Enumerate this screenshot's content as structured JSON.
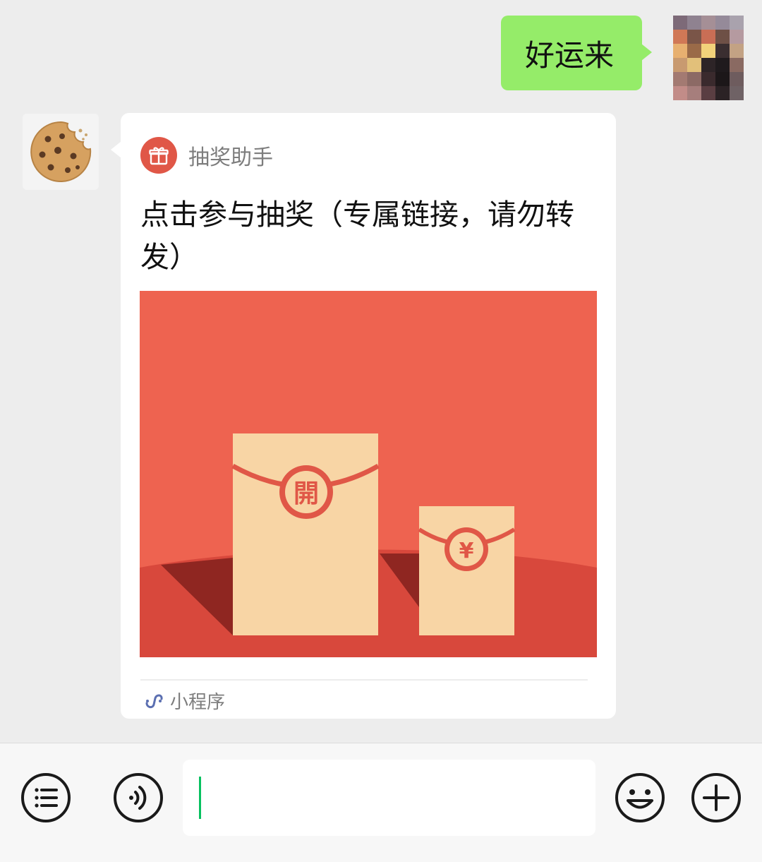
{
  "chat": {
    "sent_message": {
      "text": "好运来"
    },
    "received_card": {
      "app_name": "抽奖助手",
      "title": "点击参与抽奖（专属链接，请勿转发）",
      "image": {
        "big_envelope_char": "開",
        "small_envelope_char": "¥"
      },
      "footer_label": "小程序"
    }
  },
  "input_bar": {
    "voice_icon": "voice-icon",
    "menu_icon": "list-icon",
    "emoji_icon": "emoji-icon",
    "plus_icon": "plus-icon",
    "input_value": ""
  },
  "colors": {
    "background": "#ededed",
    "sent_bubble": "#95ec69",
    "card": "#ffffff",
    "envelope_bg": "#ee6350",
    "envelope_paper": "#f8d5a5",
    "accent_red": "#e05747",
    "cursor": "#07c160"
  }
}
